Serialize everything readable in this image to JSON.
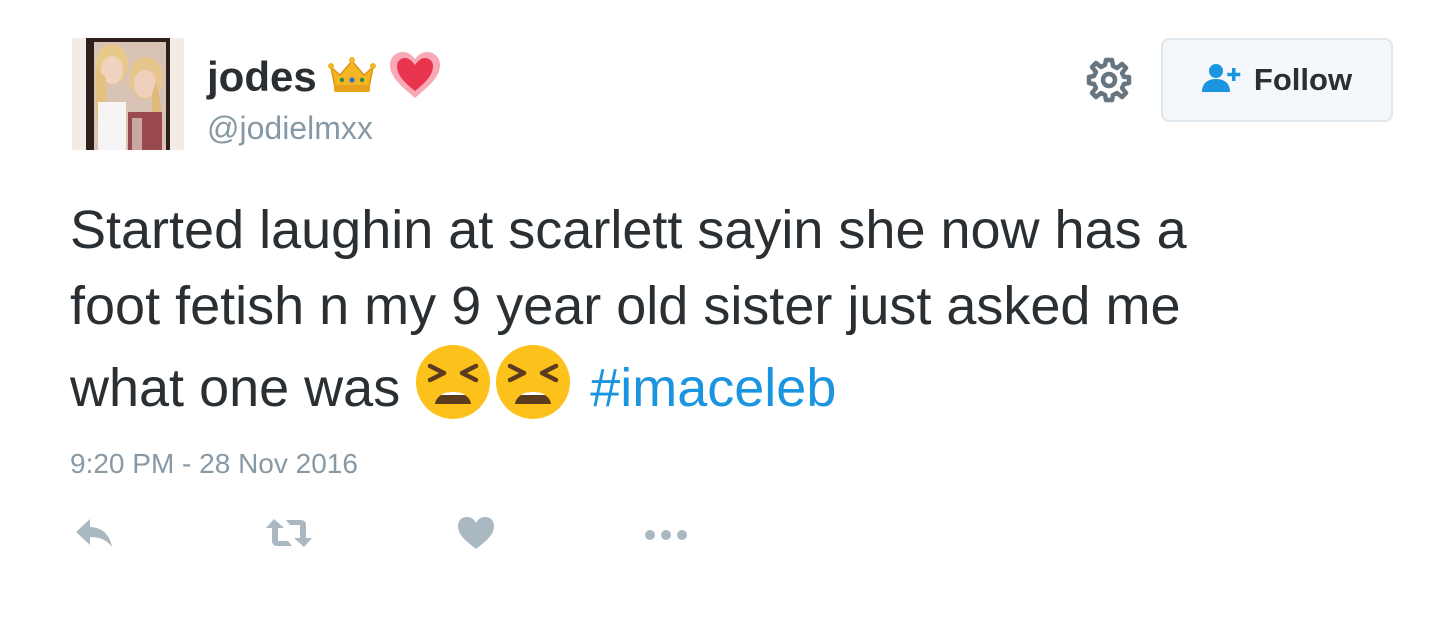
{
  "user": {
    "display_name": "jodes",
    "handle": "@jodielmxx",
    "name_emojis": [
      "crown-icon",
      "sparkling-heart-icon"
    ]
  },
  "header": {
    "follow_label": "Follow",
    "settings_icon": "gear-icon",
    "follow_icon": "add-user-icon"
  },
  "tweet": {
    "text_line_1": "Started laughin at scarlett sayin she now has a",
    "text_line_2": "foot fetish n my 9 year old sister just asked me",
    "text_line_3": "what one was",
    "emojis": [
      "tired-face-icon",
      "tired-face-icon"
    ],
    "hashtag": "#imaceleb",
    "timestamp": "9:20 PM - 28 Nov 2016"
  },
  "actions": [
    "reply-icon",
    "retweet-icon",
    "like-icon",
    "more-icon"
  ],
  "colors": {
    "text": "#292f33",
    "muted": "#8899a6",
    "link": "#1b95e0",
    "icon": "#aab8c2",
    "follow_icon": "#1b95e0"
  }
}
